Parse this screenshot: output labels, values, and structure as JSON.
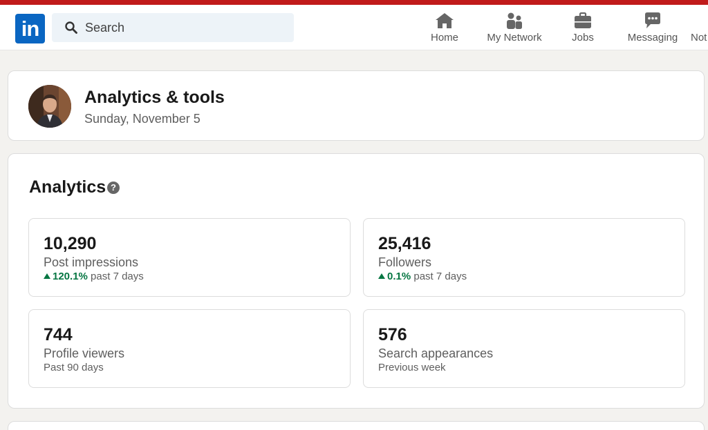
{
  "nav": {
    "search_placeholder": "Search",
    "items": [
      {
        "label": "Home",
        "icon": "home-icon"
      },
      {
        "label": "My Network",
        "icon": "network-icon"
      },
      {
        "label": "Jobs",
        "icon": "briefcase-icon"
      },
      {
        "label": "Messaging",
        "icon": "messaging-icon"
      },
      {
        "label": "Not",
        "icon": "notifications-icon"
      }
    ]
  },
  "header": {
    "title": "Analytics & tools",
    "date": "Sunday, November 5"
  },
  "analytics": {
    "title": "Analytics",
    "stats": [
      {
        "value": "10,290",
        "label": "Post impressions",
        "change": "120.1%",
        "period": "past 7 days"
      },
      {
        "value": "25,416",
        "label": "Followers",
        "change": "0.1%",
        "period": "past 7 days"
      },
      {
        "value": "744",
        "label": "Profile viewers",
        "period": "Past 90 days"
      },
      {
        "value": "576",
        "label": "Search appearances",
        "period": "Previous week"
      }
    ]
  },
  "colors": {
    "brand": "#0a66c2",
    "positive": "#057642",
    "top_stripe": "#c11b1b"
  }
}
